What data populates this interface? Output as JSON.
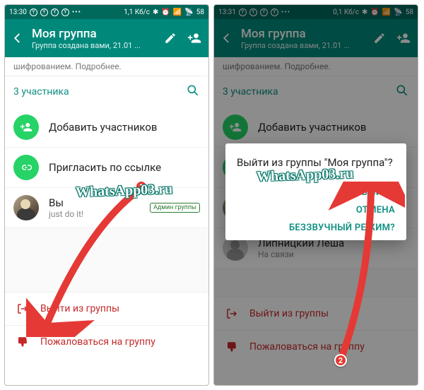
{
  "watermark": "WhatsApp03.ru",
  "annotations": {
    "badge1": "1",
    "badge2": "2"
  },
  "left": {
    "statusbar": {
      "time": "13:30",
      "net": "1,1 Кб/с",
      "batt": "58"
    },
    "appbar": {
      "title": "Моя группа",
      "subtitle": "Группа создана вами, 21.01 ..."
    },
    "hint": "шифрованием. Подробнее.",
    "participants_header": "3 участника",
    "add_row": "Добавить участников",
    "invite_row": "Пригласить по ссылке",
    "me": {
      "name": "Вы",
      "status": "just do it!",
      "badge": "Админ группы"
    },
    "leave": "Выйти из группы",
    "report": "Пожаловаться на группу"
  },
  "right": {
    "statusbar": {
      "time": "13:31",
      "net": "0,1 Кб/с",
      "batt": "58"
    },
    "appbar": {
      "title": "Моя группа",
      "subtitle": "Группа создана вами, 21.01 ..."
    },
    "hint": "шифрованием. Подробнее.",
    "participants_header": "3 участника",
    "add_row": "Добавить участников",
    "invite_row": "Пригласить по ссылке",
    "contact": {
      "name": "Липницкий Леша",
      "status": "На связи"
    },
    "leave": "Выйти из группы",
    "report": "Пожаловаться на группу",
    "dialog": {
      "title": "Выйти из группы \"Моя группа\"?",
      "confirm": "ВЫЙТИ",
      "cancel": "ОТМЕНА",
      "mute": "БЕЗЗВУЧНЫЙ РЕЖИМ?"
    }
  }
}
